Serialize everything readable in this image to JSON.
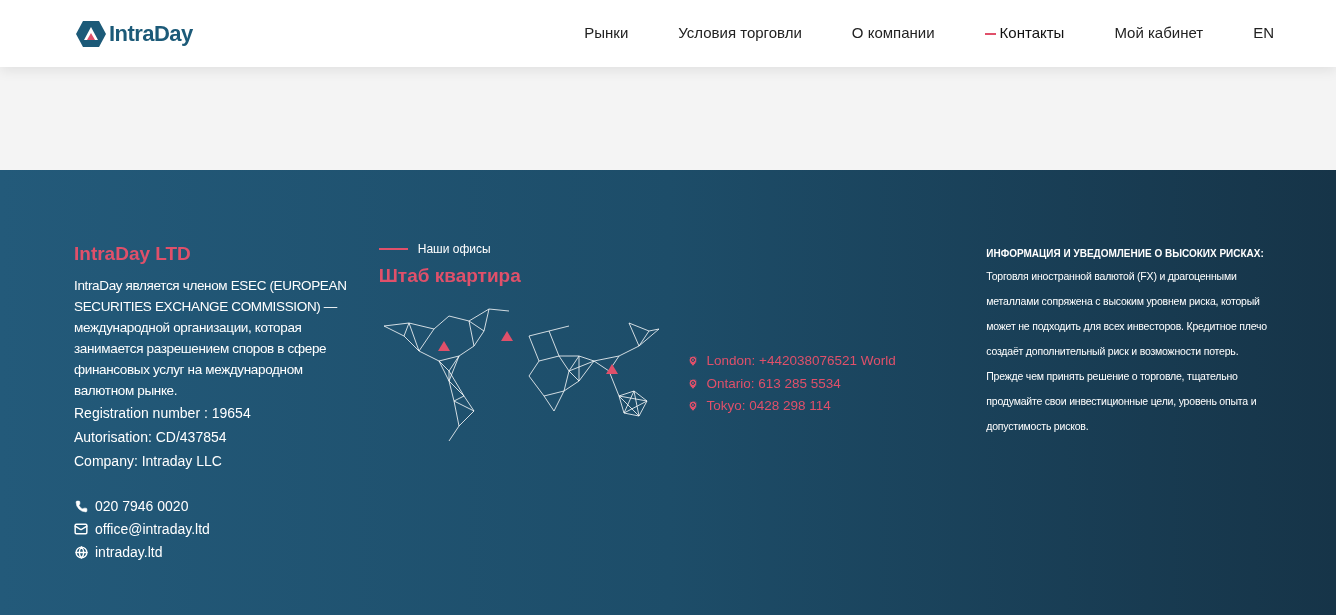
{
  "header": {
    "logo": "IntraDay",
    "nav": [
      {
        "label": "Рынки",
        "selected": false
      },
      {
        "label": "Условия торговли",
        "selected": false
      },
      {
        "label": "О компании",
        "selected": false
      },
      {
        "label": "Контакты",
        "selected": true
      },
      {
        "label": "Мой кабинет",
        "selected": false
      },
      {
        "label": "EN",
        "selected": false
      }
    ]
  },
  "footer": {
    "company": {
      "title": "IntraDay LTD",
      "description": "IntraDay является членом ESEC (EUROPEAN SECURITIES EXCHANGE COMMISSION) — международной организации, которая занимается разрешением споров в сфере финансовых услуг на международном валютном рынке.",
      "details": [
        "Registration number : 19654",
        "Autorisation: CD/437854",
        "Company: Intraday LLC"
      ],
      "contacts": [
        {
          "kind": "phone",
          "text": "020 7946 0020"
        },
        {
          "kind": "email",
          "text": "office@intraday.ltd"
        },
        {
          "kind": "web",
          "text": "intraday.ltd"
        }
      ]
    },
    "offices": {
      "eyebrow": "Наши офисы",
      "title": "Штаб квартира",
      "locations": [
        "London: +442038076521 World",
        "Ontario: 613 285 5534",
        "Tokyo: 0428 298 114"
      ]
    },
    "risk": {
      "title": "ИНФОРМАЦИЯ И УВЕДОМЛЕНИЕ О ВЫСОКИХ РИСКАХ:",
      "text": "Торговля иностранной валютой (FX) и драгоценными металлами сопряжена с высоким уровнем риска, который может не подходить для всех инвесторов. Кредитное плечо создаёт дополнительный риск и возможности потерь. Прежде чем принять решение о торговле, тщательно продумайте свои инвестиционные цели, уровень опыта и допустимость рисков."
    }
  }
}
